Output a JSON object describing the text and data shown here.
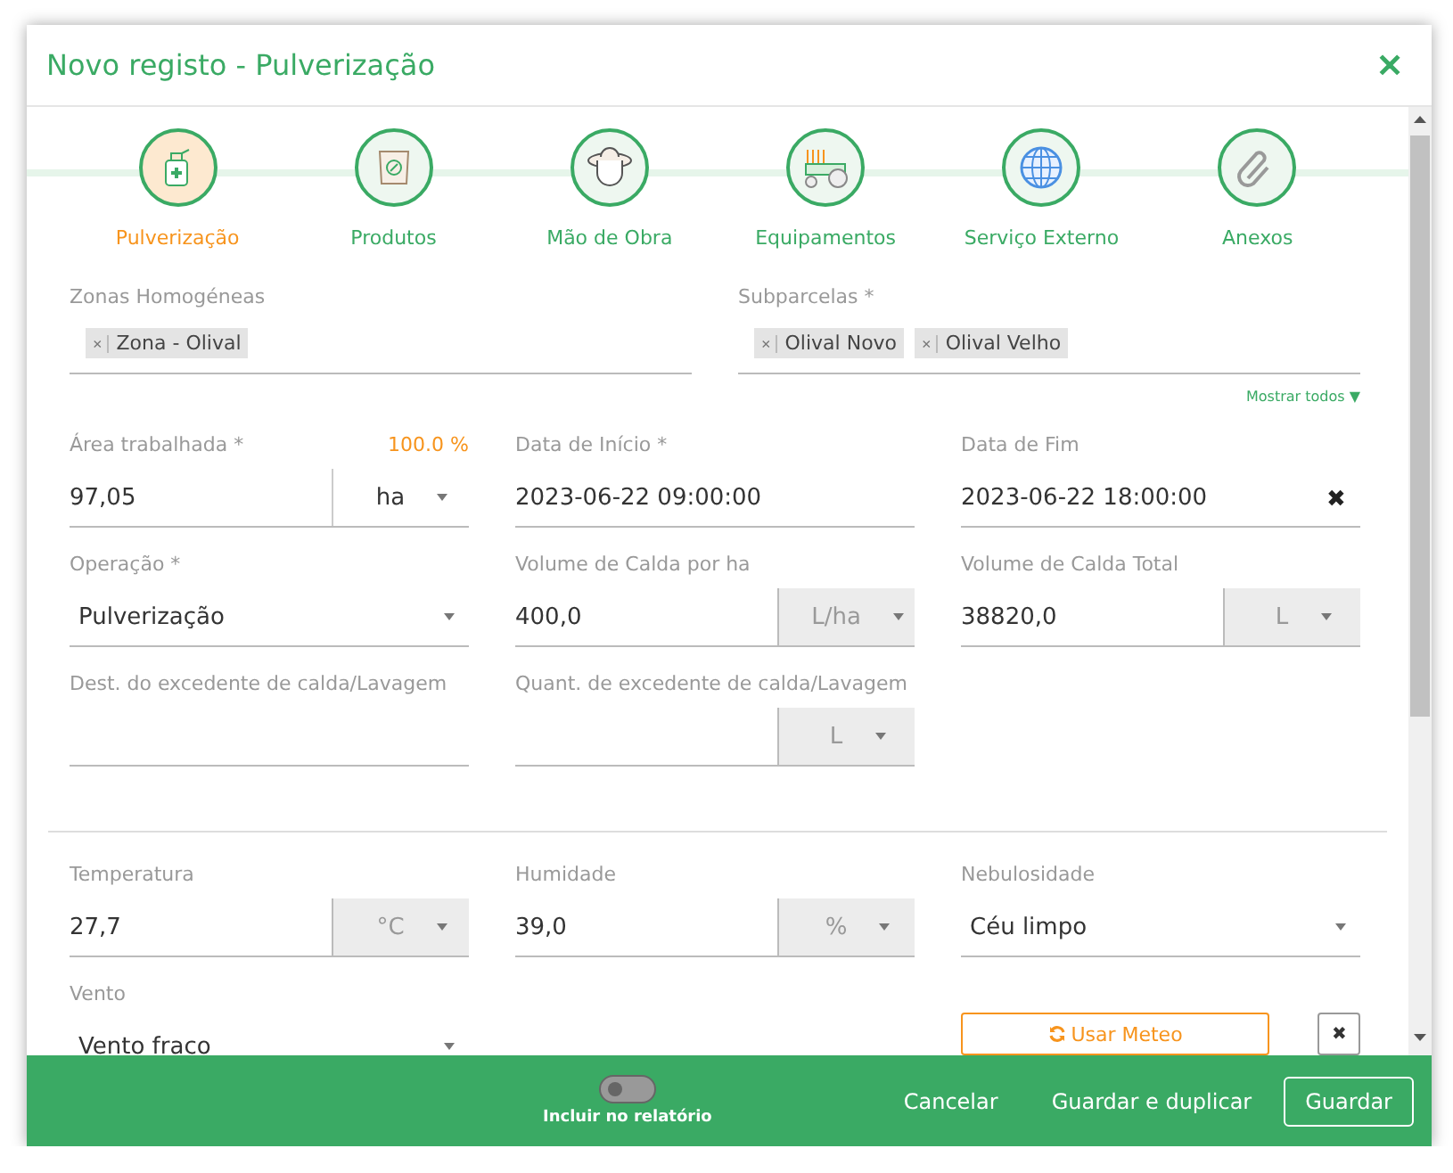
{
  "window": {
    "title": "Novo registo - Pulverização",
    "close": "✕"
  },
  "steps": [
    {
      "label": "Pulverização",
      "selected": true
    },
    {
      "label": "Produtos",
      "selected": false
    },
    {
      "label": "Mão de Obra",
      "selected": false
    },
    {
      "label": "Equipamentos",
      "selected": false
    },
    {
      "label": "Serviço Externo",
      "selected": false
    },
    {
      "label": "Anexos",
      "selected": false
    }
  ],
  "tag_fields": [
    {
      "label": "Zonas Homogéneas",
      "tags": [
        {
          "remove": "×",
          "label": "Zona - Olival"
        }
      ]
    },
    {
      "label": "Subparcelas *",
      "tags": [
        {
          "remove": "×",
          "label": "Olival Novo"
        },
        {
          "remove": "×",
          "label": "Olival Velho"
        }
      ],
      "link": "Mostrar todos ▼"
    }
  ],
  "rows": [
    [
      {
        "kind": "unit",
        "label": "Área trabalhada *",
        "extra": "100.0 %",
        "value": "97,05",
        "unit": "ha",
        "unit_disabled": false
      },
      {
        "kind": "text",
        "label": "Data de Início *",
        "value": "2023-06-22 09:00:00"
      },
      {
        "kind": "text",
        "label": "Data de Fim",
        "value": "2023-06-22 18:00:00",
        "clear": "✖"
      }
    ],
    [
      {
        "kind": "select",
        "label": "Operação *",
        "value": "Pulverização"
      },
      {
        "kind": "unit",
        "label": "Volume de Calda por ha",
        "value": "400,0",
        "unit": "L/ha",
        "unit_disabled": true
      },
      {
        "kind": "unit",
        "label": "Volume de Calda Total",
        "value": "38820,0",
        "unit": "L",
        "unit_disabled": true
      }
    ],
    [
      {
        "kind": "text",
        "label": "Dest. do excedente de calda/Lavagem"
      },
      {
        "kind": "unit",
        "label": "Quant. de excedente de calda/Lavagem",
        "unit": "L",
        "unit_disabled": true
      }
    ]
  ],
  "weather_rows": [
    [
      {
        "kind": "unit",
        "label": "Temperatura",
        "value": "27,7",
        "unit": "°C",
        "unit_disabled": true
      },
      {
        "kind": "unit",
        "label": "Humidade",
        "value": "39,0",
        "unit": "%",
        "unit_disabled": true
      },
      {
        "kind": "select",
        "label": "Nebulosidade",
        "value": "Céu limpo"
      }
    ],
    [
      {
        "kind": "select",
        "label": "Vento",
        "value": "Vento fraco"
      },
      {
        "kind": "meteo",
        "button": "Usar Meteo",
        "clear": "✖"
      }
    ]
  ],
  "footer": {
    "toggle": {
      "label": "Incluir no relatório",
      "on": false
    },
    "buttons": [
      {
        "label": "Cancelar",
        "primary": false
      },
      {
        "label": "Guardar e duplicar",
        "primary": false
      },
      {
        "label": "Guardar",
        "primary": true
      }
    ]
  }
}
